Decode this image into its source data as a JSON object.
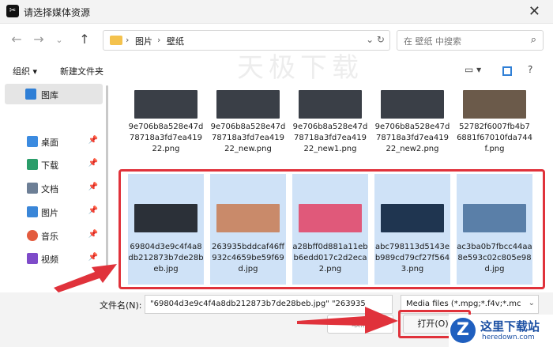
{
  "window": {
    "title": "请选择媒体资源"
  },
  "nav": {
    "breadcrumb": [
      "图片",
      "壁纸"
    ],
    "search_placeholder": "在 壁纸 中搜索"
  },
  "toolbar": {
    "organize": "组织 ▾",
    "new_folder": "新建文件夹"
  },
  "watermark": "天极下载",
  "sidebar": {
    "items": [
      {
        "label": "图库",
        "icon": "gallery-icon",
        "color": "#2f7fd6",
        "pinned": false
      },
      {
        "label": "桌面",
        "icon": "desktop-icon",
        "color": "#3b8be0",
        "pinned": true
      },
      {
        "label": "下载",
        "icon": "download-icon",
        "color": "#2a9d6a",
        "pinned": true
      },
      {
        "label": "文档",
        "icon": "document-icon",
        "color": "#6d7f96",
        "pinned": true
      },
      {
        "label": "图片",
        "icon": "pictures-icon",
        "color": "#3a86d8",
        "pinned": true
      },
      {
        "label": "音乐",
        "icon": "music-icon",
        "color": "#e35b3e",
        "pinned": true
      },
      {
        "label": "视频",
        "icon": "video-icon",
        "color": "#7e4bc9",
        "pinned": true
      }
    ]
  },
  "files_row1": [
    {
      "name": "9e706b8a528e47d78718a3fd7ea41922.png",
      "thumb": "#3a3f47"
    },
    {
      "name": "9e706b8a528e47d78718a3fd7ea41922_new.png",
      "thumb": "#3a3f47"
    },
    {
      "name": "9e706b8a528e47d78718a3fd7ea41922_new1.png",
      "thumb": "#3a3f47"
    },
    {
      "name": "9e706b8a528e47d78718a3fd7ea41922_new2.png",
      "thumb": "#3a3f47"
    },
    {
      "name": "52782f6007fb4b76881f67010fda744f.png",
      "thumb": "#6b5a4a"
    }
  ],
  "files_row2": [
    {
      "name": "69804d3e9c4f4a8db212873b7de28beb.jpg",
      "thumb": "#2b3038"
    },
    {
      "name": "263935bddcaf46ff932c4659be59f69d.jpg",
      "thumb": "#c98a6a"
    },
    {
      "name": "a28bff0d881a11ebb6edd017c2d2eca2.png",
      "thumb": "#e0597a"
    },
    {
      "name": "abc798113d5143eb989cd79cf27f5643.png",
      "thumb": "#1f3550"
    },
    {
      "name": "ac3ba0b7fbcc44aa8e593c02c805e98d.jpg",
      "thumb": "#5a7fa8"
    }
  ],
  "footer": {
    "filename_label": "文件名(N):",
    "filename_value": "\"69804d3e9c4f4a8db212873b7de28beb.jpg\" \"263935",
    "filter_value": "Media files (*.mpg;*.f4v;*.mc",
    "open": "打开(O)",
    "cancel": "取消"
  },
  "branding": {
    "cn": "这里下载站",
    "en": "heredown.com"
  },
  "colors": {
    "highlight": "#e0323b",
    "selection": "#cfe2f7"
  }
}
